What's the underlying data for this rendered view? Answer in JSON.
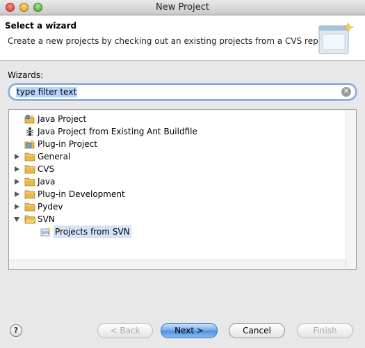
{
  "window": {
    "title": "New Project"
  },
  "banner": {
    "title": "Select a wizard",
    "description": "Create a new projects by checking out an existing projects from a CVS repository."
  },
  "wizards_label": "Wizards:",
  "search": {
    "value": "type filter text",
    "placeholder": "type filter text"
  },
  "tree": {
    "items": [
      {
        "label": "Java Project",
        "icon": "java-project-icon",
        "expandable": false,
        "expanded": false
      },
      {
        "label": "Java Project from Existing Ant Buildfile",
        "icon": "ant-icon",
        "expandable": false,
        "expanded": false
      },
      {
        "label": "Plug-in Project",
        "icon": "plugin-project-icon",
        "expandable": false,
        "expanded": false
      },
      {
        "label": "General",
        "icon": "folder-icon",
        "expandable": true,
        "expanded": false
      },
      {
        "label": "CVS",
        "icon": "folder-icon",
        "expandable": true,
        "expanded": false
      },
      {
        "label": "Java",
        "icon": "folder-icon",
        "expandable": true,
        "expanded": false
      },
      {
        "label": "Plug-in Development",
        "icon": "folder-icon",
        "expandable": true,
        "expanded": false
      },
      {
        "label": "Pydev",
        "icon": "folder-icon",
        "expandable": true,
        "expanded": false
      },
      {
        "label": "SVN",
        "icon": "folder-icon",
        "expandable": true,
        "expanded": true
      },
      {
        "label": "Projects from SVN",
        "icon": "svn-icon",
        "expandable": false,
        "selected": true
      }
    ]
  },
  "buttons": {
    "help": "?",
    "back": "< Back",
    "next": "Next >",
    "cancel": "Cancel",
    "finish": "Finish"
  },
  "colors": {
    "selection": "#d4e3f7",
    "default_button": "#6fa8ea",
    "folder": "#e8b84a"
  }
}
